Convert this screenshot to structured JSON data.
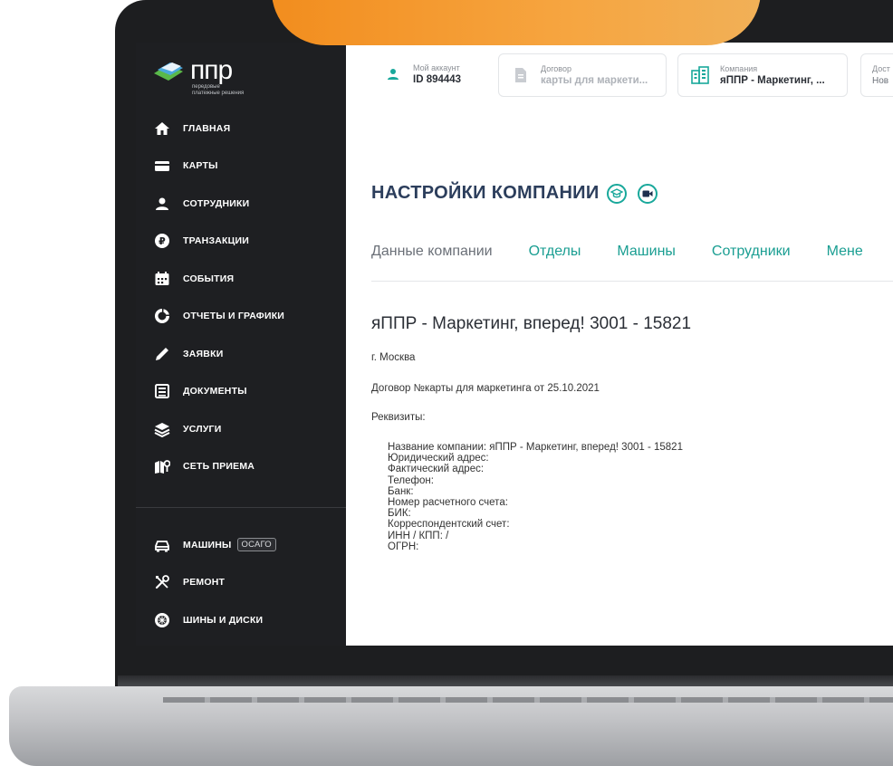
{
  "sidebar": {
    "logo_text": "ппр",
    "logo_sub": "передовые платежные решения",
    "items": [
      {
        "label": "ГЛАВНАЯ",
        "icon": "home-icon"
      },
      {
        "label": "КАРТЫ",
        "icon": "card-icon"
      },
      {
        "label": "СОТРУДНИКИ",
        "icon": "user-icon"
      },
      {
        "label": "ТРАНЗАКЦИИ",
        "icon": "ruble-icon"
      },
      {
        "label": "СОБЫТИЯ",
        "icon": "calendar-icon"
      },
      {
        "label": "ОТЧЕТЫ И ГРАФИКИ",
        "icon": "chart-icon"
      },
      {
        "label": "ЗАЯВКИ",
        "icon": "pen-icon"
      },
      {
        "label": "ДОКУМЕНТЫ",
        "icon": "document-icon"
      },
      {
        "label": "УСЛУГИ",
        "icon": "layers-icon"
      },
      {
        "label": "СЕТЬ ПРИЕМА",
        "icon": "map-icon"
      }
    ],
    "items2": [
      {
        "label": "МАШИНЫ",
        "badge": "ОСАГО",
        "icon": "car-icon"
      },
      {
        "label": "РЕМОНТ",
        "icon": "tools-icon"
      },
      {
        "label": "ШИНЫ И ДИСКИ",
        "icon": "wheel-icon"
      }
    ]
  },
  "topbar": {
    "account": {
      "label": "Мой аккаунт",
      "value": "ID 894443"
    },
    "contract": {
      "label": "Договор",
      "value": "карты для маркети..."
    },
    "company": {
      "label": "Компания",
      "value": "яППР - Маркетинг, ..."
    },
    "access": {
      "label": "Дост",
      "value": "Нов"
    }
  },
  "page": {
    "title": "НАСТРОЙКИ КОМПАНИИ",
    "tabs": [
      "Данные компании",
      "Отделы",
      "Машины",
      "Сотрудники",
      "Мене"
    ],
    "company_name": "яППР - Маркетинг, вперед! 3001 - 15821",
    "city": "г. Москва",
    "contract": "Договор №карты для маркетинга от 25.10.2021",
    "requisites_label": "Реквизиты:",
    "requisites": [
      "Название компании: яППР - Маркетинг, вперед! 3001 - 15821",
      "Юридический адрес:",
      "Фактический адрес:",
      "Телефон:",
      "Банк:",
      "Номер расчетного счета:",
      "БИК:",
      "Корреспондентский счет:",
      "ИНН / КПП:   /",
      "ОГРН:"
    ]
  },
  "colors": {
    "accent": "#1a9e92",
    "title": "#2c3e5c",
    "sidebar_bg": "#1e1f22",
    "orange": "#f28d1e"
  }
}
